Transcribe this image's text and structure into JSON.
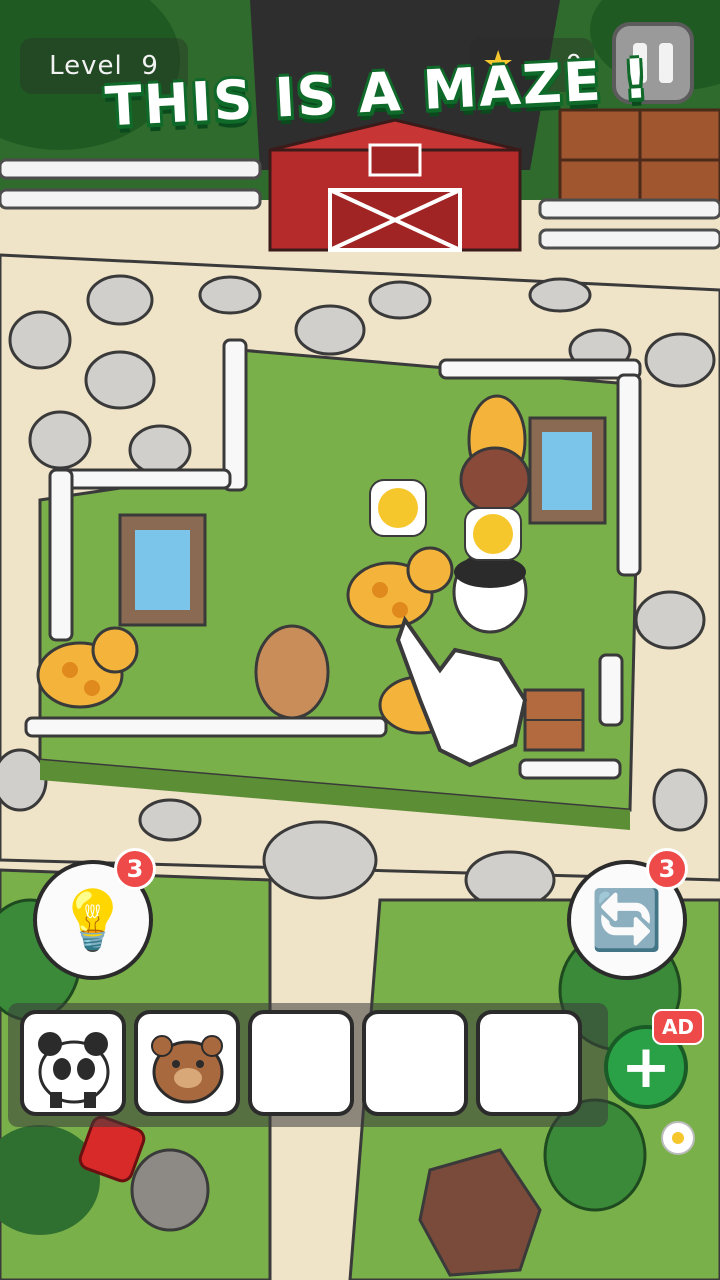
{
  "hud": {
    "level_label": "Level",
    "level_number": "9",
    "stars": "0",
    "headline": "THIS IS A MAZE !"
  },
  "powerups": {
    "hint": {
      "icon": "lightbulb-icon",
      "count": "3"
    },
    "shuffle": {
      "icon": "shuffle-arrows-icon",
      "count": "3"
    }
  },
  "tray": {
    "slots": [
      {
        "animal": "panda"
      },
      {
        "animal": "bear"
      },
      {
        "animal": ""
      },
      {
        "animal": ""
      },
      {
        "animal": ""
      }
    ],
    "add_label": "+",
    "ad_label": "AD"
  },
  "colors": {
    "grass": "#79b04a",
    "path": "#efe3c8",
    "fence": "#ffffff",
    "barn": "#b52a2a",
    "accent_green": "#2aa146",
    "badge_red": "#ef4a4a"
  }
}
